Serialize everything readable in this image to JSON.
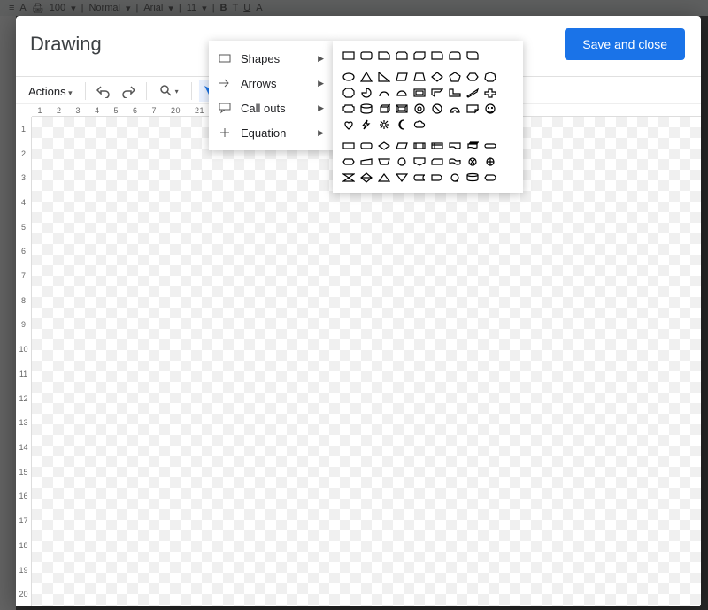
{
  "bg": {
    "zoom": "100",
    "style": "Normal",
    "font": "Arial",
    "size": "11"
  },
  "dialog": {
    "title": "Drawing",
    "save_label": "Save and close"
  },
  "toolbar": {
    "actions_label": "Actions"
  },
  "menu": {
    "items": [
      {
        "label": "Shapes"
      },
      {
        "label": "Arrows"
      },
      {
        "label": "Call outs"
      },
      {
        "label": "Equation"
      }
    ]
  },
  "ruler": {
    "h": "· 1 · · 2 · · 3 · · 4 · · 5 · · 6 · · 7 ·                                                                  · 20 · · 21 · · 22 · · 23 · · 24 · · 25 · · 26 · · 27",
    "v": [
      "1",
      "2",
      "3",
      "4",
      "5",
      "6",
      "7",
      "8",
      "9",
      "10",
      "11",
      "12",
      "13",
      "14",
      "15",
      "16",
      "17",
      "18",
      "19",
      "20"
    ]
  }
}
